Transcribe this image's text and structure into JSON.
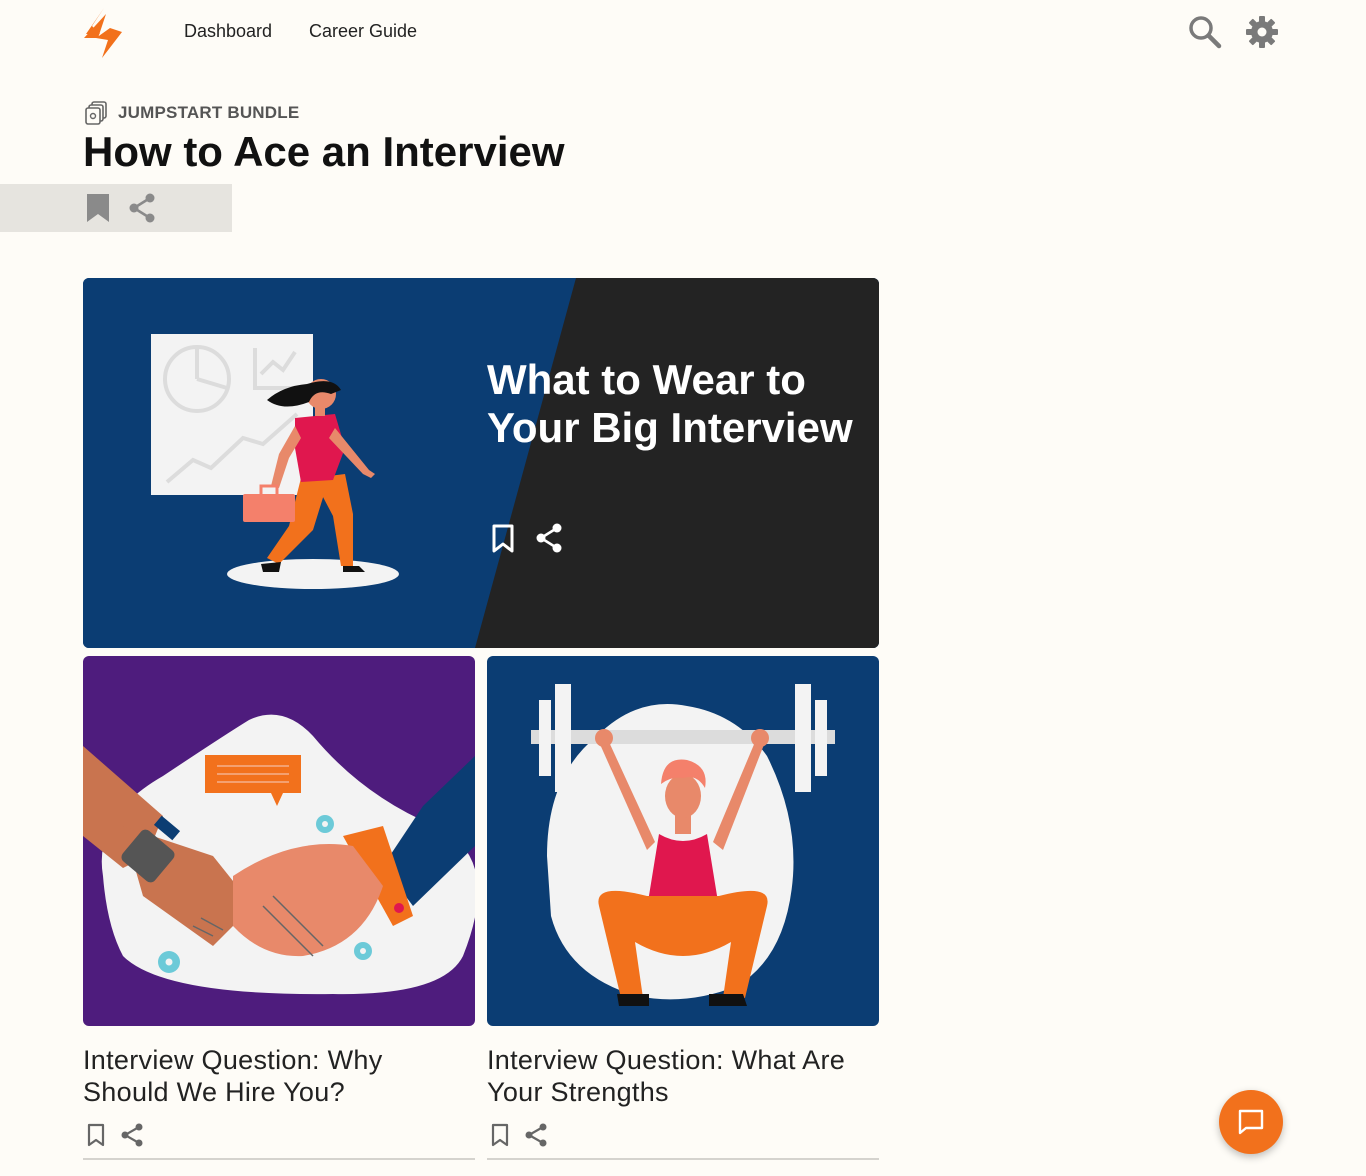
{
  "nav": {
    "logo_icon": "lightning-logo-icon",
    "links": [
      "Dashboard",
      "Career Guide"
    ],
    "search_icon": "search-icon",
    "settings_icon": "gear-icon"
  },
  "bundle": {
    "label": "JUMPSTART BUNDLE",
    "icon": "bundle-icon"
  },
  "page": {
    "title": "How to Ace an Interview",
    "bookmark_icon": "bookmark-icon",
    "share_icon": "share-icon"
  },
  "featured": {
    "title": "What to Wear to Your Big Interview",
    "bookmark_icon": "bookmark-outline-icon",
    "share_icon": "share-icon"
  },
  "cards": [
    {
      "title": "Interview Question: Why Should We Hire You?",
      "illustration": "handshake"
    },
    {
      "title": "Interview Question: What Are Your Strengths",
      "illustration": "weightlifter"
    }
  ],
  "chat": {
    "icon": "chat-icon"
  },
  "colors": {
    "accent": "#f2711c",
    "navy": "#0b3d73",
    "dark": "#232323",
    "purple": "#4e1c7d",
    "background": "#fefcf7"
  }
}
